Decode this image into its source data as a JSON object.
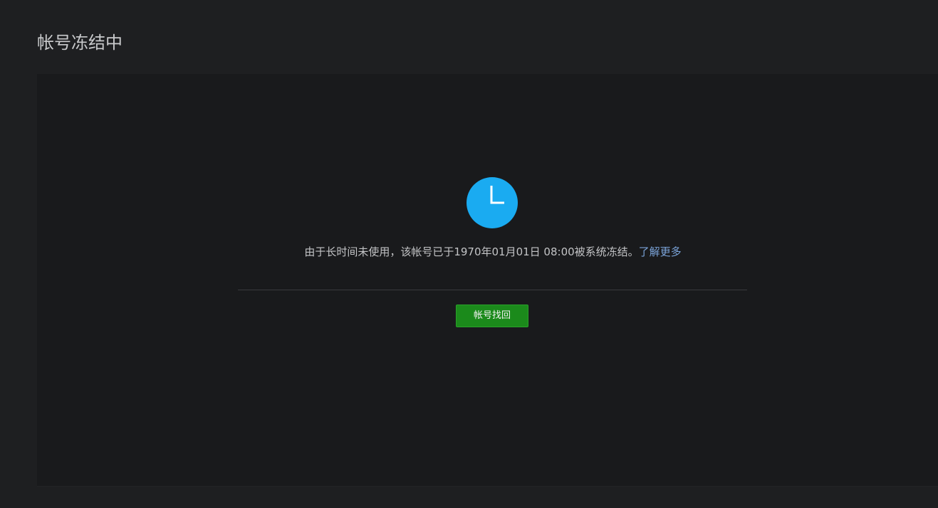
{
  "page": {
    "title": "帐号冻结中"
  },
  "status": {
    "icon": "clock-icon",
    "icon_color": "#1aabf1",
    "message": "由于长时间未使用，该帐号已于1970年01月01日 08:00被系统冻结。",
    "link_label": "了解更多",
    "link_color": "#7aa3d8"
  },
  "actions": {
    "recover_label": "帐号找回",
    "recover_color": "#1b8a1b"
  }
}
